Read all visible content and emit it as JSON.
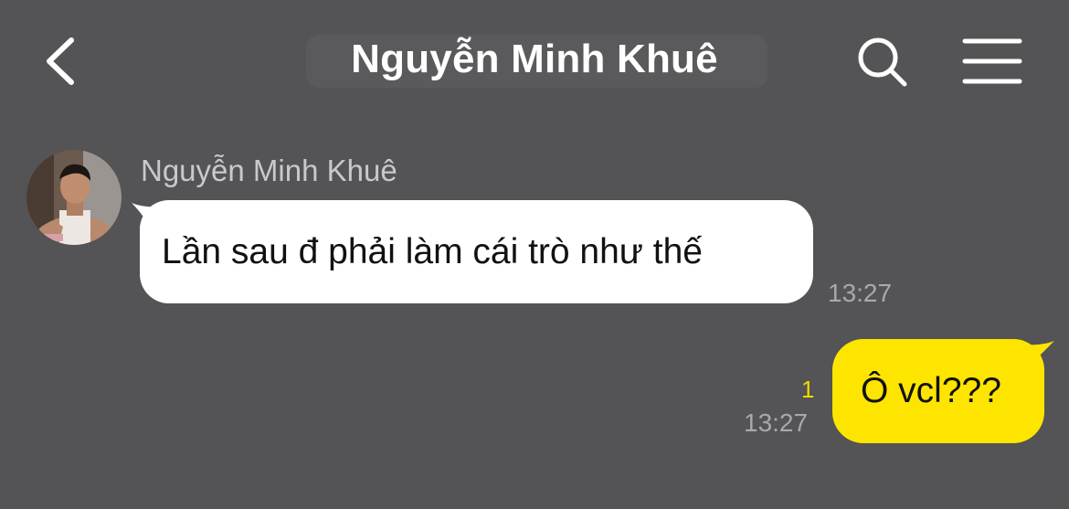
{
  "header": {
    "title": "Nguyễn Minh Khuê",
    "back_icon": "chevron-left-icon",
    "search_icon": "search-icon",
    "menu_icon": "hamburger-menu-icon"
  },
  "messages": [
    {
      "direction": "incoming",
      "sender": "Nguyễn Minh Khuê",
      "text": "Lần sau đ phải làm cái trò như thế",
      "time": "13:27",
      "bubble_color": "#ffffff"
    },
    {
      "direction": "outgoing",
      "text": "Ô vcl???",
      "time": "13:27",
      "unread_count": "1",
      "bubble_color": "#fee500"
    }
  ],
  "colors": {
    "background": "#545355",
    "outgoing_bubble": "#fee500",
    "incoming_bubble": "#ffffff",
    "unread_count": "#f4d800"
  }
}
